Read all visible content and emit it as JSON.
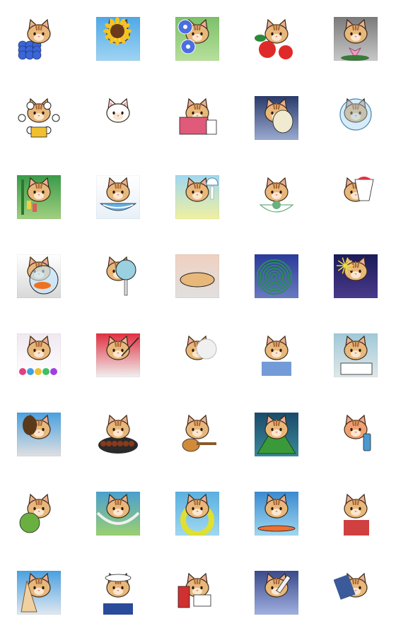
{
  "stickers": [
    {
      "name": "hydrangea-cat-sticker",
      "bg": [
        "#ffffff",
        "#ffffff"
      ],
      "prop": "hydrangea",
      "accent": "#3a66d6",
      "cat": "#e8b77a"
    },
    {
      "name": "sunflower-cat-sticker",
      "bg": [
        "#4fa8e6",
        "#9fd4f2"
      ],
      "prop": "sunflower",
      "accent": "#f5c518",
      "cat": "#e8b77a"
    },
    {
      "name": "morning-glory-cat-sticker",
      "bg": [
        "#7cc06a",
        "#b8e09c"
      ],
      "prop": "morning-glory",
      "accent": "#4a6fe0",
      "cat": "#e8b77a"
    },
    {
      "name": "hibiscus-cat-sticker",
      "bg": [
        "#ffffff",
        "#ffffff"
      ],
      "prop": "hibiscus",
      "accent": "#e02a2a",
      "cat": "#e8b77a"
    },
    {
      "name": "lotus-pond-cat-sticker",
      "bg": [
        "#7a7a7a",
        "#c8c8c8"
      ],
      "prop": "lotus",
      "accent": "#f09ac0",
      "cat": "#e8b77a"
    },
    {
      "name": "thunder-drum-cat-sticker",
      "bg": [
        "#ffffff",
        "#ffffff"
      ],
      "prop": "drums",
      "accent": "#e03030",
      "cat": "#e8b77a"
    },
    {
      "name": "ghost-cat-sticker",
      "bg": [
        "#ffffff",
        "#ffffff"
      ],
      "prop": "ghost",
      "accent": "#f0f0f0",
      "cat": "#ffffff"
    },
    {
      "name": "summer-gift-cat-sticker",
      "bg": [
        "#ffffff",
        "#ffffff"
      ],
      "prop": "gift",
      "accent": "#e05a7a",
      "cat": "#e8b77a"
    },
    {
      "name": "fan-breeze-cat-sticker",
      "bg": [
        "#2a3a6a",
        "#9aaad0"
      ],
      "prop": "uchiwa",
      "accent": "#f0ead0",
      "cat": "#e8b77a"
    },
    {
      "name": "fishbowl-helmet-cat-sticker",
      "bg": [
        "#ffffff",
        "#ffffff"
      ],
      "prop": "bowl",
      "accent": "#9ad0f0",
      "cat": "#e8b77a"
    },
    {
      "name": "tanabata-cat-sticker",
      "bg": [
        "#3a9a4a",
        "#a0d080"
      ],
      "prop": "tanabata",
      "accent": "#f0d040",
      "cat": "#e8b77a"
    },
    {
      "name": "somen-noodle-cat-sticker",
      "bg": [
        "#ffffff",
        "#e8f0f8"
      ],
      "prop": "noodles",
      "accent": "#6ab0e0",
      "cat": "#e8b77a"
    },
    {
      "name": "wind-chime-cat-sticker",
      "bg": [
        "#a0d8f0",
        "#f0f0a0"
      ],
      "prop": "chime",
      "accent": "#ffffff",
      "cat": "#e8b77a"
    },
    {
      "name": "watermelon-bowl-cat-sticker",
      "bg": [
        "#ffffff",
        "#ffffff"
      ],
      "prop": "bowl-food",
      "accent": "#6ab080",
      "cat": "#e8b77a"
    },
    {
      "name": "shaved-ice-cat-sticker",
      "bg": [
        "#ffffff",
        "#ffffff"
      ],
      "prop": "kakigori",
      "accent": "#e03040",
      "cat": "#e8b77a"
    },
    {
      "name": "goldfish-bowl-cat-sticker",
      "bg": [
        "#ffffff",
        "#d8d8d8"
      ],
      "prop": "goldfish",
      "accent": "#f07020",
      "cat": "#e8b77a"
    },
    {
      "name": "electric-fan-cat-sticker",
      "bg": [
        "#ffffff",
        "#ffffff"
      ],
      "prop": "fan",
      "accent": "#9ad0e0",
      "cat": "#e8b77a"
    },
    {
      "name": "sprawled-cat-sticker",
      "bg": [
        "#f0d0c0",
        "#e0e0e0"
      ],
      "prop": "lying",
      "accent": "#c0c0c0",
      "cat": "#e8b77a"
    },
    {
      "name": "mosquito-coil-cat-sticker",
      "bg": [
        "#2a3a9a",
        "#6a7ac0"
      ],
      "prop": "coil",
      "accent": "#2a8a5a",
      "cat": "#e8b77a"
    },
    {
      "name": "fireworks-cat-sticker",
      "bg": [
        "#1a1a5a",
        "#4a3a8a"
      ],
      "prop": "fireworks",
      "accent": "#f0e040",
      "cat": "#e8b77a"
    },
    {
      "name": "festival-stall-cat-sticker",
      "bg": [
        "#f0e8f0",
        "#ffffff"
      ],
      "prop": "yoyo",
      "accent": "#e04080",
      "cat": "#e8b77a"
    },
    {
      "name": "conductor-cat-sticker",
      "bg": [
        "#e03040",
        "#f0f0f0"
      ],
      "prop": "baton",
      "accent": "#ffffff",
      "cat": "#e8b77a"
    },
    {
      "name": "cotton-candy-cat-sticker",
      "bg": [
        "#ffffff",
        "#ffffff"
      ],
      "prop": "cotton-candy",
      "accent": "#f0f0f0",
      "cat": "#e8b77a"
    },
    {
      "name": "mask-festival-cat-sticker",
      "bg": [
        "#ffffff",
        "#ffffff"
      ],
      "prop": "mask",
      "accent": "#5a8ad0",
      "cat": "#e8b77a"
    },
    {
      "name": "homework-cat-sticker",
      "bg": [
        "#a0c8d8",
        "#e0e8e8"
      ],
      "prop": "book",
      "accent": "#ffffff",
      "cat": "#e8b77a"
    },
    {
      "name": "beetle-cat-sticker",
      "bg": [
        "#4aa0e0",
        "#e0e0e0"
      ],
      "prop": "beetle",
      "accent": "#5a3a1a",
      "cat": "#e8b77a"
    },
    {
      "name": "bbq-cat-sticker",
      "bg": [
        "#ffffff",
        "#ffffff"
      ],
      "prop": "bbq",
      "accent": "#8a3a1a",
      "cat": "#e8b77a"
    },
    {
      "name": "ukulele-cat-sticker",
      "bg": [
        "#ffffff",
        "#ffffff"
      ],
      "prop": "ukulele",
      "accent": "#d08a3a",
      "cat": "#e8b77a"
    },
    {
      "name": "camping-tent-cat-sticker",
      "bg": [
        "#1a4a6a",
        "#3a8a9a"
      ],
      "prop": "tent",
      "accent": "#3a9a3a",
      "cat": "#e8b77a"
    },
    {
      "name": "sunscreen-cat-sticker",
      "bg": [
        "#ffffff",
        "#ffffff"
      ],
      "prop": "sunscreen",
      "accent": "#4a9ad0",
      "cat": "#f0a070"
    },
    {
      "name": "coconut-drink-cat-sticker",
      "bg": [
        "#ffffff",
        "#ffffff"
      ],
      "prop": "coconut",
      "accent": "#6ab040",
      "cat": "#e8b77a"
    },
    {
      "name": "hammock-cat-sticker",
      "bg": [
        "#4aa0d0",
        "#9ad070"
      ],
      "prop": "hammock",
      "accent": "#f0f0f0",
      "cat": "#e8b77a"
    },
    {
      "name": "swim-ring-cat-sticker",
      "bg": [
        "#5ab0e0",
        "#a0d8f0"
      ],
      "prop": "swim-ring",
      "accent": "#e0e030",
      "cat": "#e8b77a"
    },
    {
      "name": "surfing-cat-sticker",
      "bg": [
        "#3a8ad0",
        "#a0d8f0"
      ],
      "prop": "surf",
      "accent": "#f07030",
      "cat": "#e8b77a"
    },
    {
      "name": "aloha-shirt-cat-sticker",
      "bg": [
        "#ffffff",
        "#ffffff"
      ],
      "prop": "aloha",
      "accent": "#d04040",
      "cat": "#e8b77a"
    },
    {
      "name": "seashell-cat-sticker",
      "bg": [
        "#4aa0e0",
        "#e0e8f0"
      ],
      "prop": "shell",
      "accent": "#f0d0a0",
      "cat": "#e8b77a"
    },
    {
      "name": "sailor-cat-sticker",
      "bg": [
        "#ffffff",
        "#ffffff"
      ],
      "prop": "sailor",
      "accent": "#2a4a9a",
      "cat": "#e8b77a"
    },
    {
      "name": "mailbox-postcard-cat-sticker",
      "bg": [
        "#ffffff",
        "#ffffff"
      ],
      "prop": "mailbox",
      "accent": "#d03030",
      "cat": "#e8b77a"
    },
    {
      "name": "injection-cat-sticker",
      "bg": [
        "#3a4a8a",
        "#a0b0e0"
      ],
      "prop": "syringe",
      "accent": "#f0f0f0",
      "cat": "#e8b77a"
    },
    {
      "name": "ice-pack-cat-sticker",
      "bg": [
        "#ffffff",
        "#ffffff"
      ],
      "prop": "towel",
      "accent": "#3a5a9a",
      "cat": "#e8b77a"
    }
  ]
}
